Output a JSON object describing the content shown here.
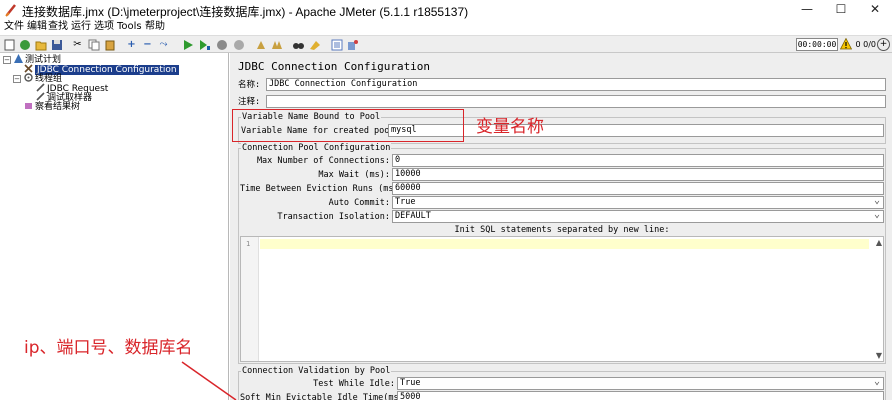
{
  "window": {
    "title": "连接数据库.jmx (D:\\jmeterproject\\连接数据库.jmx) - Apache JMeter (5.1.1 r1855137)",
    "minimize": "—",
    "maximize": "☐",
    "close": "✕"
  },
  "menu": [
    "文件",
    "编辑",
    "查找",
    "运行",
    "选项",
    "Tools",
    "帮助"
  ],
  "toolbar": {
    "timer": "00:00:00",
    "counts": "0 0/0"
  },
  "tree": {
    "items": [
      {
        "label": "测试计划",
        "icon": "test-plan-icon"
      },
      {
        "label": "JDBC Connection Configuration",
        "icon": "config-element-icon"
      },
      {
        "label": "线程组",
        "icon": "thread-group-icon"
      },
      {
        "label": "JDBC Request",
        "icon": "sampler-icon"
      },
      {
        "label": "调试取样器",
        "icon": "sampler-icon"
      },
      {
        "label": "察看结果树",
        "icon": "listener-icon"
      }
    ]
  },
  "panel": {
    "title": "JDBC Connection Configuration",
    "name_label": "名称:",
    "name_value": "JDBC Connection Configuration",
    "comment_label": "注释:",
    "comment_value": "",
    "var_group_title": "Variable Name Bound to Pool",
    "var_label": "Variable Name for created pool:",
    "var_value": "mysql",
    "pool_group_title": "Connection Pool Configuration",
    "pool_fields": [
      {
        "label": "Max Number of Connections:",
        "value": "0"
      },
      {
        "label": "Max Wait (ms):",
        "value": "10000"
      },
      {
        "label": "Time Between Eviction Runs (ms):",
        "value": "60000"
      },
      {
        "label": "Auto Commit:",
        "value": "True"
      },
      {
        "label": "Transaction Isolation:",
        "value": "DEFAULT"
      }
    ],
    "init_sql_label": "Init SQL statements separated by new line:",
    "init_sql_line": "1",
    "validation_group_title": "Connection Validation by Pool",
    "validation_fields": [
      {
        "label": "Test While Idle:",
        "value": "True"
      },
      {
        "label": "Soft Min Evictable Idle Time(ms):",
        "value": "5000"
      }
    ]
  },
  "annotations": {
    "var_note": "变量名称",
    "db_note": "ip、端口号、数据库名"
  },
  "colors": {
    "annotation_red": "#d9252a",
    "tree_selection": "#1c3e8c",
    "panel_bg": "#eeeeee",
    "current_line": "#ffffcc"
  }
}
